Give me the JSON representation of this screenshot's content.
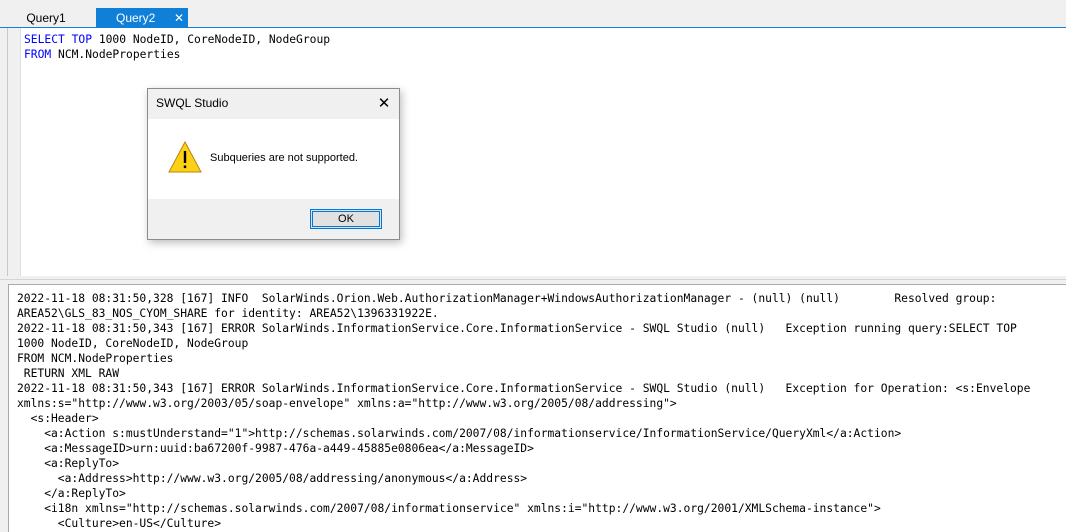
{
  "tabs": [
    {
      "label": "Query1",
      "active": false
    },
    {
      "label": "Query2",
      "active": true
    }
  ],
  "tab_close_glyph": "✕",
  "editor": {
    "lines": [
      [
        {
          "t": "SELECT TOP",
          "kw": true
        },
        {
          "t": " 1000 NodeID, CoreNodeID, NodeGroup",
          "kw": false
        }
      ],
      [
        {
          "t": "FROM",
          "kw": true
        },
        {
          "t": " NCM.NodeProperties",
          "kw": false
        }
      ]
    ]
  },
  "dialog": {
    "title": "SWQL Studio",
    "close_glyph": "✕",
    "message": "Subqueries are not supported.",
    "ok_label": "OK",
    "icon": "warning-icon",
    "icon_color": "#fcd116"
  },
  "log": {
    "lines": [
      "2022-11-18 08:31:50,328 [167] INFO  SolarWinds.Orion.Web.AuthorizationManager+WindowsAuthorizationManager - (null) (null)        Resolved group:",
      "AREA52\\GLS_83_NOS_CYOM_SHARE for identity: AREA52\\1396331922E.",
      "2022-11-18 08:31:50,343 [167] ERROR SolarWinds.InformationService.Core.InformationService - SWQL Studio (null)   Exception running query:SELECT TOP",
      "1000 NodeID, CoreNodeID, NodeGroup",
      "FROM NCM.NodeProperties",
      " RETURN XML RAW",
      "2022-11-18 08:31:50,343 [167] ERROR SolarWinds.InformationService.Core.InformationService - SWQL Studio (null)   Exception for Operation: <s:Envelope",
      "xmlns:s=\"http://www.w3.org/2003/05/soap-envelope\" xmlns:a=\"http://www.w3.org/2005/08/addressing\">",
      "  <s:Header>",
      "    <a:Action s:mustUnderstand=\"1\">http://schemas.solarwinds.com/2007/08/informationservice/InformationService/QueryXml</a:Action>",
      "    <a:MessageID>urn:uuid:ba67200f-9987-476a-a449-45885e0806ea</a:MessageID>",
      "    <a:ReplyTo>",
      "      <a:Address>http://www.w3.org/2005/08/addressing/anonymous</a:Address>",
      "    </a:ReplyTo>",
      "    <i18n xmlns=\"http://schemas.solarwinds.com/2007/08/informationservice\" xmlns:i=\"http://www.w3.org/2001/XMLSchema-instance\">",
      "      <Culture>en-US</Culture>"
    ]
  },
  "colors": {
    "accent": "#0f7fd8",
    "keyword": "#0000ff"
  }
}
